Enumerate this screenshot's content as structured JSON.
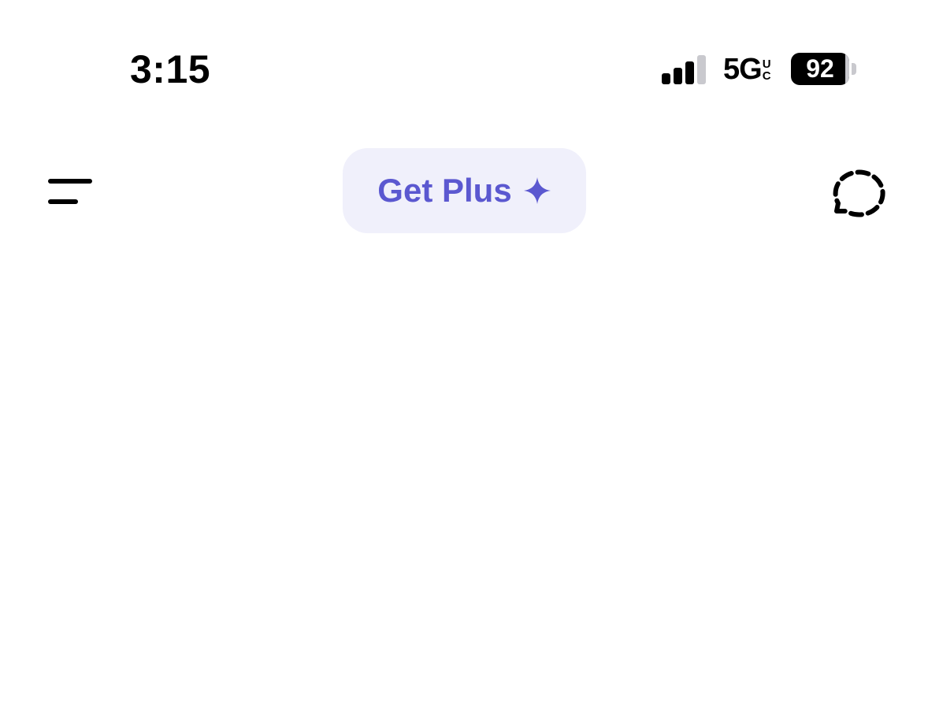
{
  "status_bar": {
    "time": "3:15",
    "network": "5G",
    "network_suffix_top": "U",
    "network_suffix_bottom": "C",
    "battery_level": "92",
    "signal_bars_filled": 3,
    "signal_bars_total": 4
  },
  "header": {
    "menu_icon": "menu-icon",
    "get_plus_label": "Get Plus",
    "sparkle_icon": "sparkle-icon",
    "new_chat_icon": "temporary-chat-icon"
  },
  "colors": {
    "accent": "#5b58d0",
    "pill_background": "#f0f0fb",
    "background": "#ffffff",
    "text": "#000000"
  }
}
